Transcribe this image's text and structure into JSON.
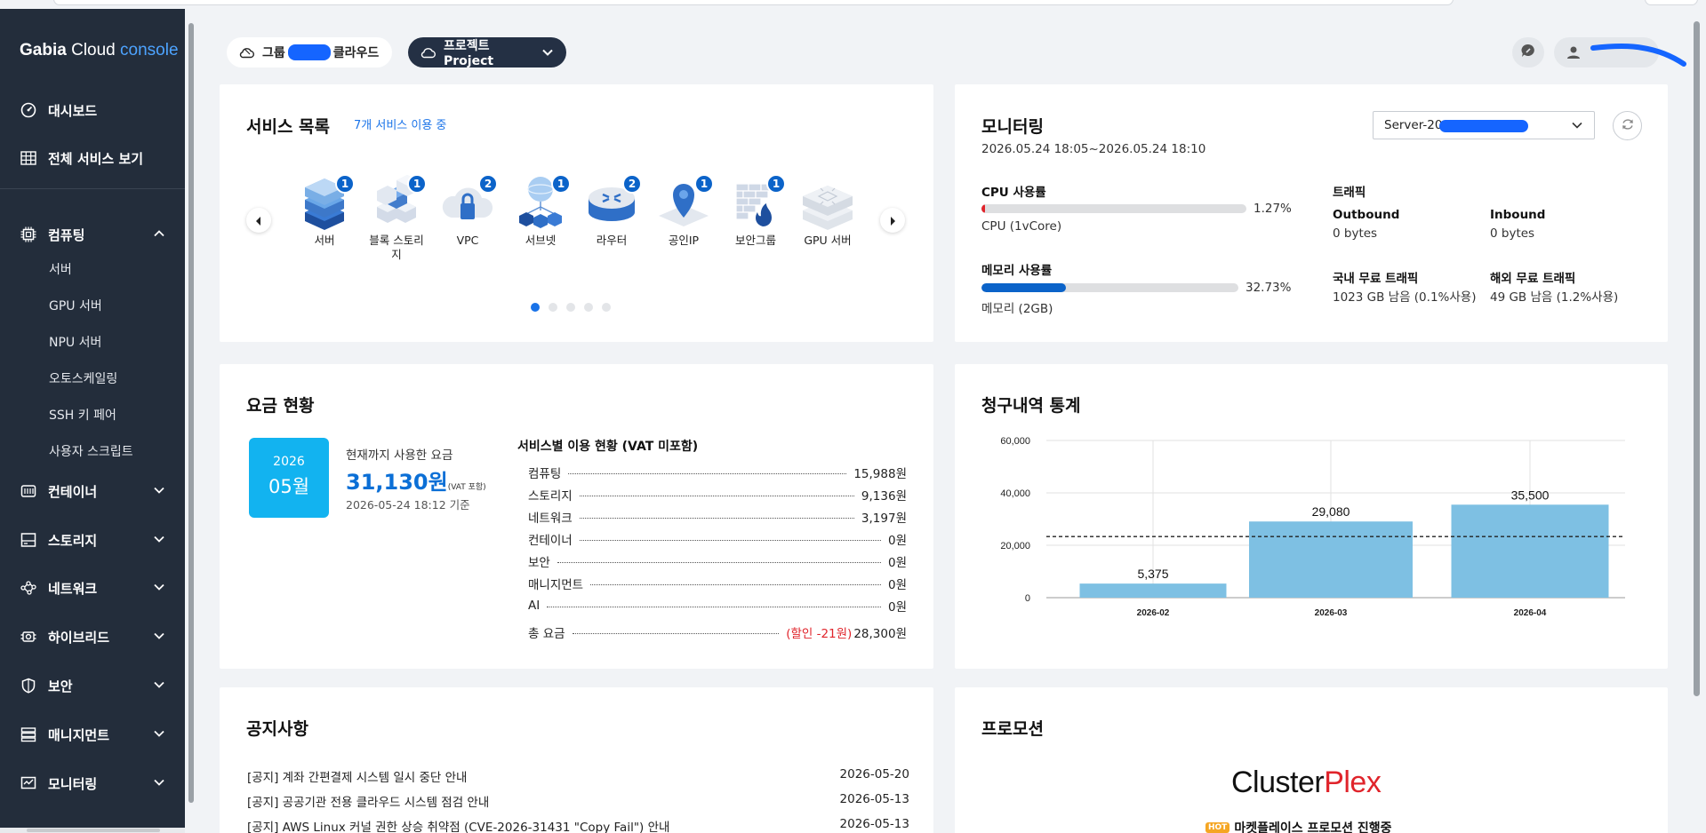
{
  "brand": {
    "name": "Gabia",
    "cloud": "Cloud",
    "console": "console"
  },
  "sidebar": {
    "top_items": [
      {
        "label": "대시보드",
        "icon": "dashboard-icon"
      },
      {
        "label": "전체 서비스 보기",
        "icon": "grid-icon"
      }
    ],
    "computing": {
      "label": "컴퓨팅",
      "icon": "cpu-icon",
      "expanded": true,
      "subitems": [
        "서버",
        "GPU 서버",
        "NPU 서버",
        "오토스케일링",
        "SSH 키 페어",
        "사용자 스크립트"
      ]
    },
    "groups": [
      {
        "label": "컨테이너",
        "icon": "container-icon"
      },
      {
        "label": "스토리지",
        "icon": "storage-icon"
      },
      {
        "label": "네트워크",
        "icon": "network-icon"
      },
      {
        "label": "하이브리드",
        "icon": "hybrid-icon"
      },
      {
        "label": "보안",
        "icon": "shield-icon"
      },
      {
        "label": "매니지먼트",
        "icon": "management-icon"
      },
      {
        "label": "모니터링",
        "icon": "monitor-icon"
      }
    ]
  },
  "header": {
    "group_chip": {
      "prefix": "그룹",
      "suffix": "클라우드"
    },
    "project_chip": {
      "label": "프로젝트 Project"
    }
  },
  "services": {
    "title": "서비스 목록",
    "usage_link": "7개 서비스 이용 중",
    "items": [
      {
        "label": "서버",
        "count": "1"
      },
      {
        "label": "블록 스토리지",
        "count": "1"
      },
      {
        "label": "VPC",
        "count": "2"
      },
      {
        "label": "서브넷",
        "count": "1"
      },
      {
        "label": "라우터",
        "count": "2"
      },
      {
        "label": "공인IP",
        "count": "1"
      },
      {
        "label": "보안그룹",
        "count": "1"
      },
      {
        "label": "GPU 서버",
        "count": ""
      }
    ],
    "page_count": 5,
    "active_page": 1
  },
  "monitoring": {
    "title": "모니터링",
    "range": "2026.05.24 18:05~2026.05.24 18:10",
    "server_select": "Server-20",
    "cpu": {
      "label": "CPU 사용률",
      "value": "1.27%",
      "fraction": 0.0127,
      "detail": "CPU (1vCore)"
    },
    "memory": {
      "label": "메모리 사용률",
      "value": "32.73%",
      "fraction": 0.3273,
      "detail": "메모리 (2GB)"
    },
    "traffic": {
      "label": "트래픽",
      "outbound_label": "Outbound",
      "outbound_value": "0 bytes",
      "inbound_label": "Inbound",
      "inbound_value": "0 bytes",
      "domestic_label": "국내 무료 트래픽",
      "domestic_value": "1023 GB 남음 (0.1%사용)",
      "overseas_label": "해외 무료 트래픽",
      "overseas_value": "49 GB 남음 (1.2%사용)"
    },
    "colors": {
      "cpu": "#e0242b",
      "memory": "#0b63c9"
    }
  },
  "billing": {
    "title": "요금 현황",
    "year": "2026",
    "month": "05월",
    "used_label": "현재까지 사용한 요금",
    "amount": "31,130원",
    "vat": "(VAT 포함)",
    "as_of": "2026-05-24 18:12 기준",
    "breakdown_title": "서비스별 이용 현황 (VAT 미포함)",
    "rows": [
      {
        "name": "컴퓨팅",
        "value": "15,988원"
      },
      {
        "name": "스토리지",
        "value": "9,136원"
      },
      {
        "name": "네트워크",
        "value": "3,197원"
      },
      {
        "name": "컨테이너",
        "value": "0원"
      },
      {
        "name": "보안",
        "value": "0원"
      },
      {
        "name": "매니지먼트",
        "value": "0원"
      },
      {
        "name": "AI",
        "value": "0원"
      }
    ],
    "total": {
      "name": "총 요금",
      "discount": "(할인 -21원)",
      "value": "28,300원"
    }
  },
  "chart_data": {
    "type": "bar",
    "title": "청구내역 통계",
    "categories": [
      "2026-02",
      "2026-03",
      "2026-04"
    ],
    "values": [
      5375,
      29080,
      35500
    ],
    "value_labels": [
      "5,375",
      "29,080",
      "35,500"
    ],
    "y_ticks": [
      "0",
      "20,000",
      "40,000",
      "60,000"
    ],
    "ylim": [
      0,
      60000
    ],
    "average_line": 23318,
    "bar_color": "#7ec0e3",
    "grid": true
  },
  "notices": {
    "title": "공지사항",
    "items": [
      {
        "title": "[공지] 계좌 간편결제 시스템 일시 중단 안내",
        "date": "2026-05-20"
      },
      {
        "title": "[공지] 공공기관 전용 클라우드 시스템 점검 안내",
        "date": "2026-05-13"
      },
      {
        "title": "[공지] AWS Linux 커널 권한 상승 취약점 (CVE-2026-31431 \"Copy Fail\") 안내",
        "date": "2026-05-13"
      }
    ]
  },
  "promotion": {
    "title": "프로모션",
    "logo_a": "Cluster",
    "logo_b": "Plex",
    "badge": "HOT",
    "subtitle": "마켓플레이스 프로모션 진행중"
  }
}
